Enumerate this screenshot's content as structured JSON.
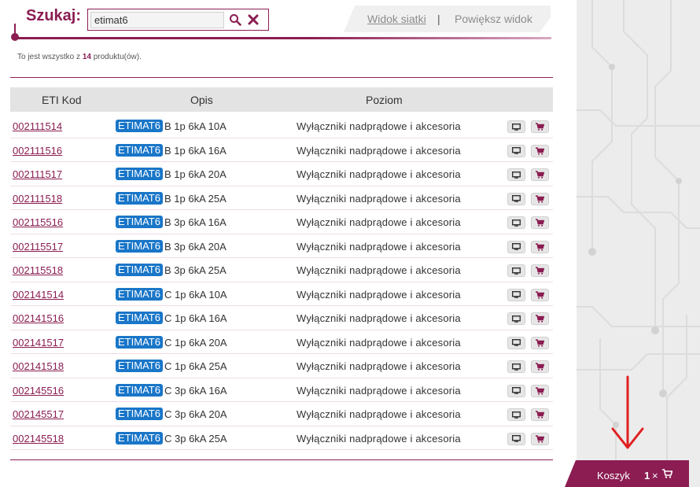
{
  "search": {
    "label": "Szukaj:",
    "value": "etimat6"
  },
  "view_tabs": {
    "grid": "Widok siatki",
    "separator": "|",
    "zoom": "Powiększ widok"
  },
  "result_count": {
    "prefix": "To jest wszystko z ",
    "count": "14",
    "suffix": " produktu(ów)."
  },
  "table": {
    "headers": {
      "code": "ETI Kod",
      "desc": "Opis",
      "level": "Poziom"
    },
    "rows": [
      {
        "code": "002111514",
        "badge": "ETIMAT6",
        "desc": "B 1p 6kA 10A",
        "level": "Wyłączniki nadprądowe i akcesoria"
      },
      {
        "code": "002111516",
        "badge": "ETIMAT6",
        "desc": "B 1p 6kA 16A",
        "level": "Wyłączniki nadprądowe i akcesoria"
      },
      {
        "code": "002111517",
        "badge": "ETIMAT6",
        "desc": "B 1p 6kA 20A",
        "level": "Wyłączniki nadprądowe i akcesoria"
      },
      {
        "code": "002111518",
        "badge": "ETIMAT6",
        "desc": "B 1p 6kA 25A",
        "level": "Wyłączniki nadprądowe i akcesoria"
      },
      {
        "code": "002115516",
        "badge": "ETIMAT6",
        "desc": "B 3p 6kA 16A",
        "level": "Wyłączniki nadprądowe i akcesoria"
      },
      {
        "code": "002115517",
        "badge": "ETIMAT6",
        "desc": "B 3p 6kA 20A",
        "level": "Wyłączniki nadprądowe i akcesoria"
      },
      {
        "code": "002115518",
        "badge": "ETIMAT6",
        "desc": "B 3p 6kA 25A",
        "level": "Wyłączniki nadprądowe i akcesoria"
      },
      {
        "code": "002141514",
        "badge": "ETIMAT6",
        "desc": "C 1p 6kA 10A",
        "level": "Wyłączniki nadprądowe i akcesoria"
      },
      {
        "code": "002141516",
        "badge": "ETIMAT6",
        "desc": "C 1p 6kA 16A",
        "level": "Wyłączniki nadprądowe i akcesoria"
      },
      {
        "code": "002141517",
        "badge": "ETIMAT6",
        "desc": "C 1p 6kA 20A",
        "level": "Wyłączniki nadprądowe i akcesoria"
      },
      {
        "code": "002141518",
        "badge": "ETIMAT6",
        "desc": "C 1p 6kA 25A",
        "level": "Wyłączniki nadprądowe i akcesoria"
      },
      {
        "code": "002145516",
        "badge": "ETIMAT6",
        "desc": "C 3p 6kA 16A",
        "level": "Wyłączniki nadprądowe i akcesoria"
      },
      {
        "code": "002145517",
        "badge": "ETIMAT6",
        "desc": "C 3p 6kA 20A",
        "level": "Wyłączniki nadprądowe i akcesoria"
      },
      {
        "code": "002145518",
        "badge": "ETIMAT6",
        "desc": "C 3p 6kA 25A",
        "level": "Wyłączniki nadprądowe i akcesoria"
      }
    ]
  },
  "basket": {
    "label": "Koszyk",
    "count": "1",
    "times": "×"
  },
  "colors": {
    "brand": "#8b1d52",
    "badge": "#1976c8",
    "annotation_arrow": "#e02020"
  },
  "icons": [
    "search-icon",
    "close-icon",
    "monitor-icon",
    "cart-icon"
  ]
}
